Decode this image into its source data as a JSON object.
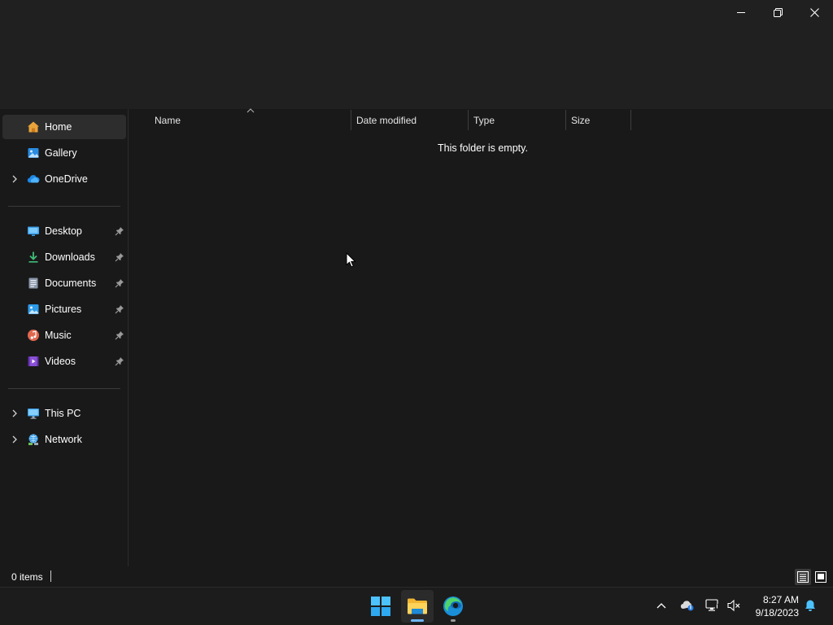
{
  "window": {
    "controls": {
      "minimize_icon": "minimize-icon",
      "restore_icon": "restore-icon",
      "close_icon": "close-icon"
    }
  },
  "nav": {
    "quick": [
      {
        "label": "Home",
        "icon": "home-icon",
        "selected": true
      },
      {
        "label": "Gallery",
        "icon": "gallery-icon"
      },
      {
        "label": "OneDrive",
        "icon": "onedrive-icon",
        "expandable": true
      }
    ],
    "pinned": [
      {
        "label": "Desktop",
        "icon": "desktop-folder-icon",
        "pinned": true
      },
      {
        "label": "Downloads",
        "icon": "downloads-folder-icon",
        "pinned": true
      },
      {
        "label": "Documents",
        "icon": "documents-folder-icon",
        "pinned": true
      },
      {
        "label": "Pictures",
        "icon": "pictures-folder-icon",
        "pinned": true
      },
      {
        "label": "Music",
        "icon": "music-folder-icon",
        "pinned": true
      },
      {
        "label": "Videos",
        "icon": "videos-folder-icon",
        "pinned": true
      }
    ],
    "locations": [
      {
        "label": "This PC",
        "icon": "this-pc-icon",
        "expandable": true
      },
      {
        "label": "Network",
        "icon": "network-icon",
        "expandable": true
      }
    ]
  },
  "content": {
    "columns": [
      "Name",
      "Date modified",
      "Type",
      "Size"
    ],
    "empty_message": "This folder is empty."
  },
  "status": {
    "item_count": "0 items"
  },
  "taskbar": {
    "apps": [
      "start-icon",
      "file-explorer-icon",
      "edge-icon"
    ],
    "tray": [
      "show-hidden-icons-chevron",
      "onedrive-status-icon",
      "network-icon",
      "volume-muted-icon"
    ],
    "time": "8:27 AM",
    "date": "9/18/2023",
    "notification_icon": "notification-bell-icon"
  },
  "colors": {
    "background": "#191919",
    "titlebar": "#202020",
    "taskbar": "#1c1c1c",
    "accent": "#60cdff",
    "selected_nav": "#2d2d2d"
  }
}
